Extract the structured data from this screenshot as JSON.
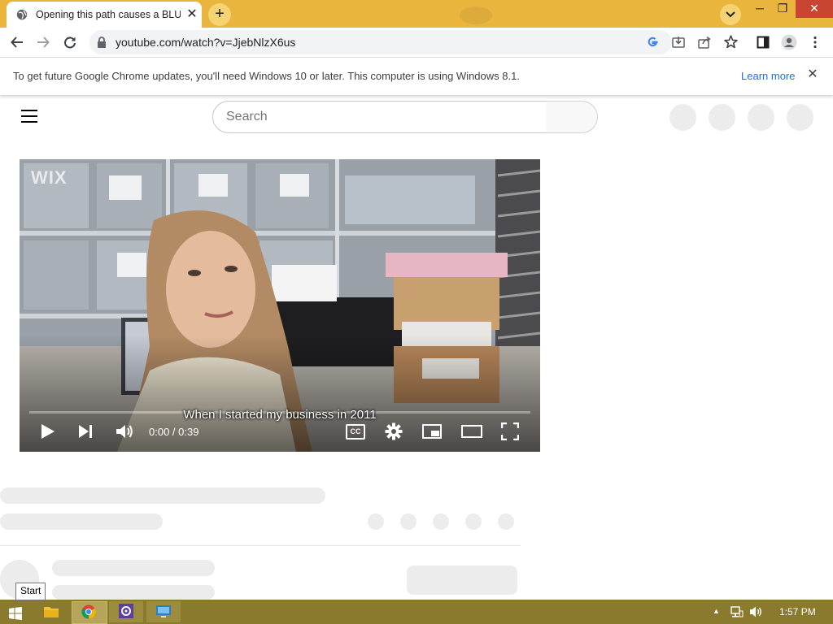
{
  "browser": {
    "tab_title": "Opening this path causes a BLUE",
    "url": "youtube.com/watch?v=JjebNlzX6us",
    "accent_color": "#e9b53c"
  },
  "infobar": {
    "message": "To get future Google Chrome updates, you'll need Windows 10 or later. This computer is using Windows 8.1.",
    "link": "Learn more"
  },
  "youtube": {
    "search_placeholder": "Search",
    "video": {
      "watermark": "WIX",
      "caption": "When I started my business in 2011",
      "time": "0:00 / 0:39",
      "cc_label": "CC"
    }
  },
  "taskbar": {
    "start_tooltip": "Start",
    "clock": "1:57 PM",
    "color": "#8a7a2e"
  }
}
